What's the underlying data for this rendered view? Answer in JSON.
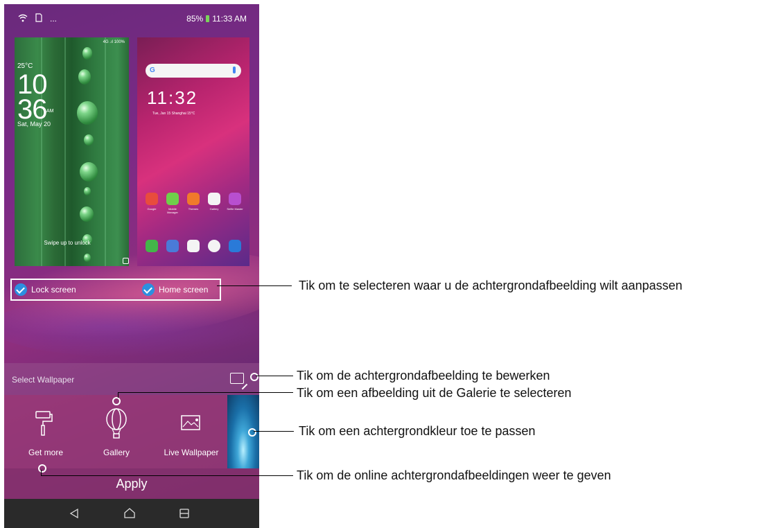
{
  "status_bar": {
    "icons": [
      "wifi-icon",
      "sd-card-icon",
      "more-icon"
    ],
    "more": "...",
    "battery": "85%",
    "time": "11:33 AM"
  },
  "lock_preview": {
    "signal": "4G .ıl 100%",
    "temp": "25°C",
    "hour": "10",
    "minute": "36",
    "ampm": "AM",
    "date": "Sat, May 20",
    "swipe": "Swipe up to unlock"
  },
  "home_preview": {
    "search_g": "G",
    "clock": "11:32",
    "sub": "Tue, Jan 15  Shanghai 15°C",
    "apps_row1": [
      "Google",
      "Mobile Manager",
      "Themes",
      "Gallery",
      "Selfie Master"
    ],
    "apps_row2_colors": [
      "#43b649",
      "#4a7bd8",
      "#f4f4f4",
      "#f4f4f4",
      "#2a7ad8"
    ],
    "apps_row1_colors": [
      "#e84c3d",
      "#6fcf4a",
      "#f07a2b",
      "#f4f4f4",
      "#b84fd0"
    ]
  },
  "targets": {
    "lock_label": "Lock screen",
    "home_label": "Home screen"
  },
  "select_wallpaper": {
    "label": "Select Wallpaper"
  },
  "options": {
    "get_more": "Get more",
    "gallery": "Gallery",
    "live": "Live Wallpaper"
  },
  "apply": "Apply",
  "callouts": {
    "select_target": "Tik om te selecteren waar u de achtergrondafbeelding wilt aanpassen",
    "edit": "Tik om de achtergrondafbeelding te bewerken",
    "gallery": "Tik om een afbeelding uit de Galerie te selecteren",
    "color": "Tik om een achtergrondkleur toe te passen",
    "online": "Tik om de online achtergrondafbeeldingen weer te geven"
  }
}
